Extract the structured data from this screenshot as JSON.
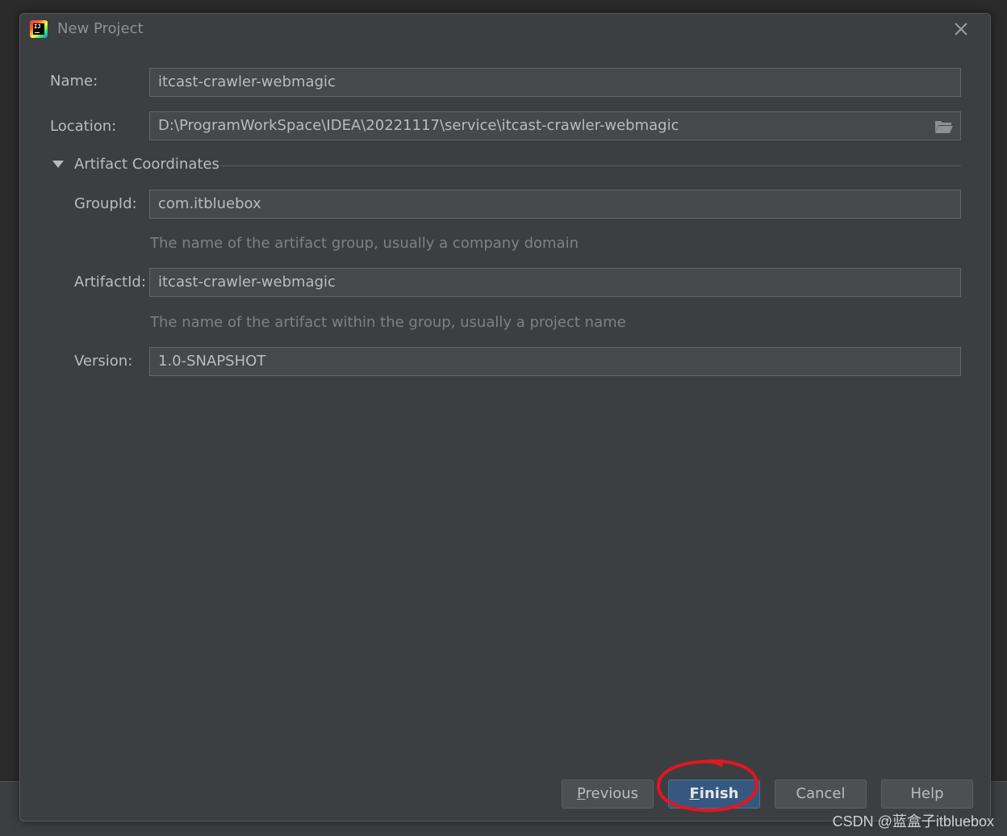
{
  "dialog": {
    "title": "New Project",
    "app_icon_text": "IJ"
  },
  "form": {
    "name_label": "Name:",
    "name_value": "itcast-crawler-webmagic",
    "location_label": "Location:",
    "location_value": "D:\\ProgramWorkSpace\\IDEA\\20221117\\service\\itcast-crawler-webmagic"
  },
  "artifact_section": {
    "title": "Artifact Coordinates",
    "expanded": true,
    "group_id_label": "GroupId:",
    "group_id_value": "com.itbluebox",
    "group_id_hint": "The name of the artifact group, usually a company domain",
    "artifact_id_label": "ArtifactId:",
    "artifact_id_value": "itcast-crawler-webmagic",
    "artifact_id_hint": "The name of the artifact within the group, usually a project name",
    "version_label": "Version:",
    "version_value": "1.0-SNAPSHOT"
  },
  "buttons": {
    "previous_mnemonic": "P",
    "previous_rest": "revious",
    "finish_mnemonic": "F",
    "finish_rest": "inish",
    "cancel": "Cancel",
    "help": "Help"
  },
  "watermark": "CSDN @蓝盒子itbluebox",
  "colors": {
    "dialog_bg": "#3c3f41",
    "field_bg": "#45494a",
    "text": "#bbbbbb",
    "hint_text": "#808080",
    "primary_button": "#365880",
    "annotation": "#e8141e"
  }
}
